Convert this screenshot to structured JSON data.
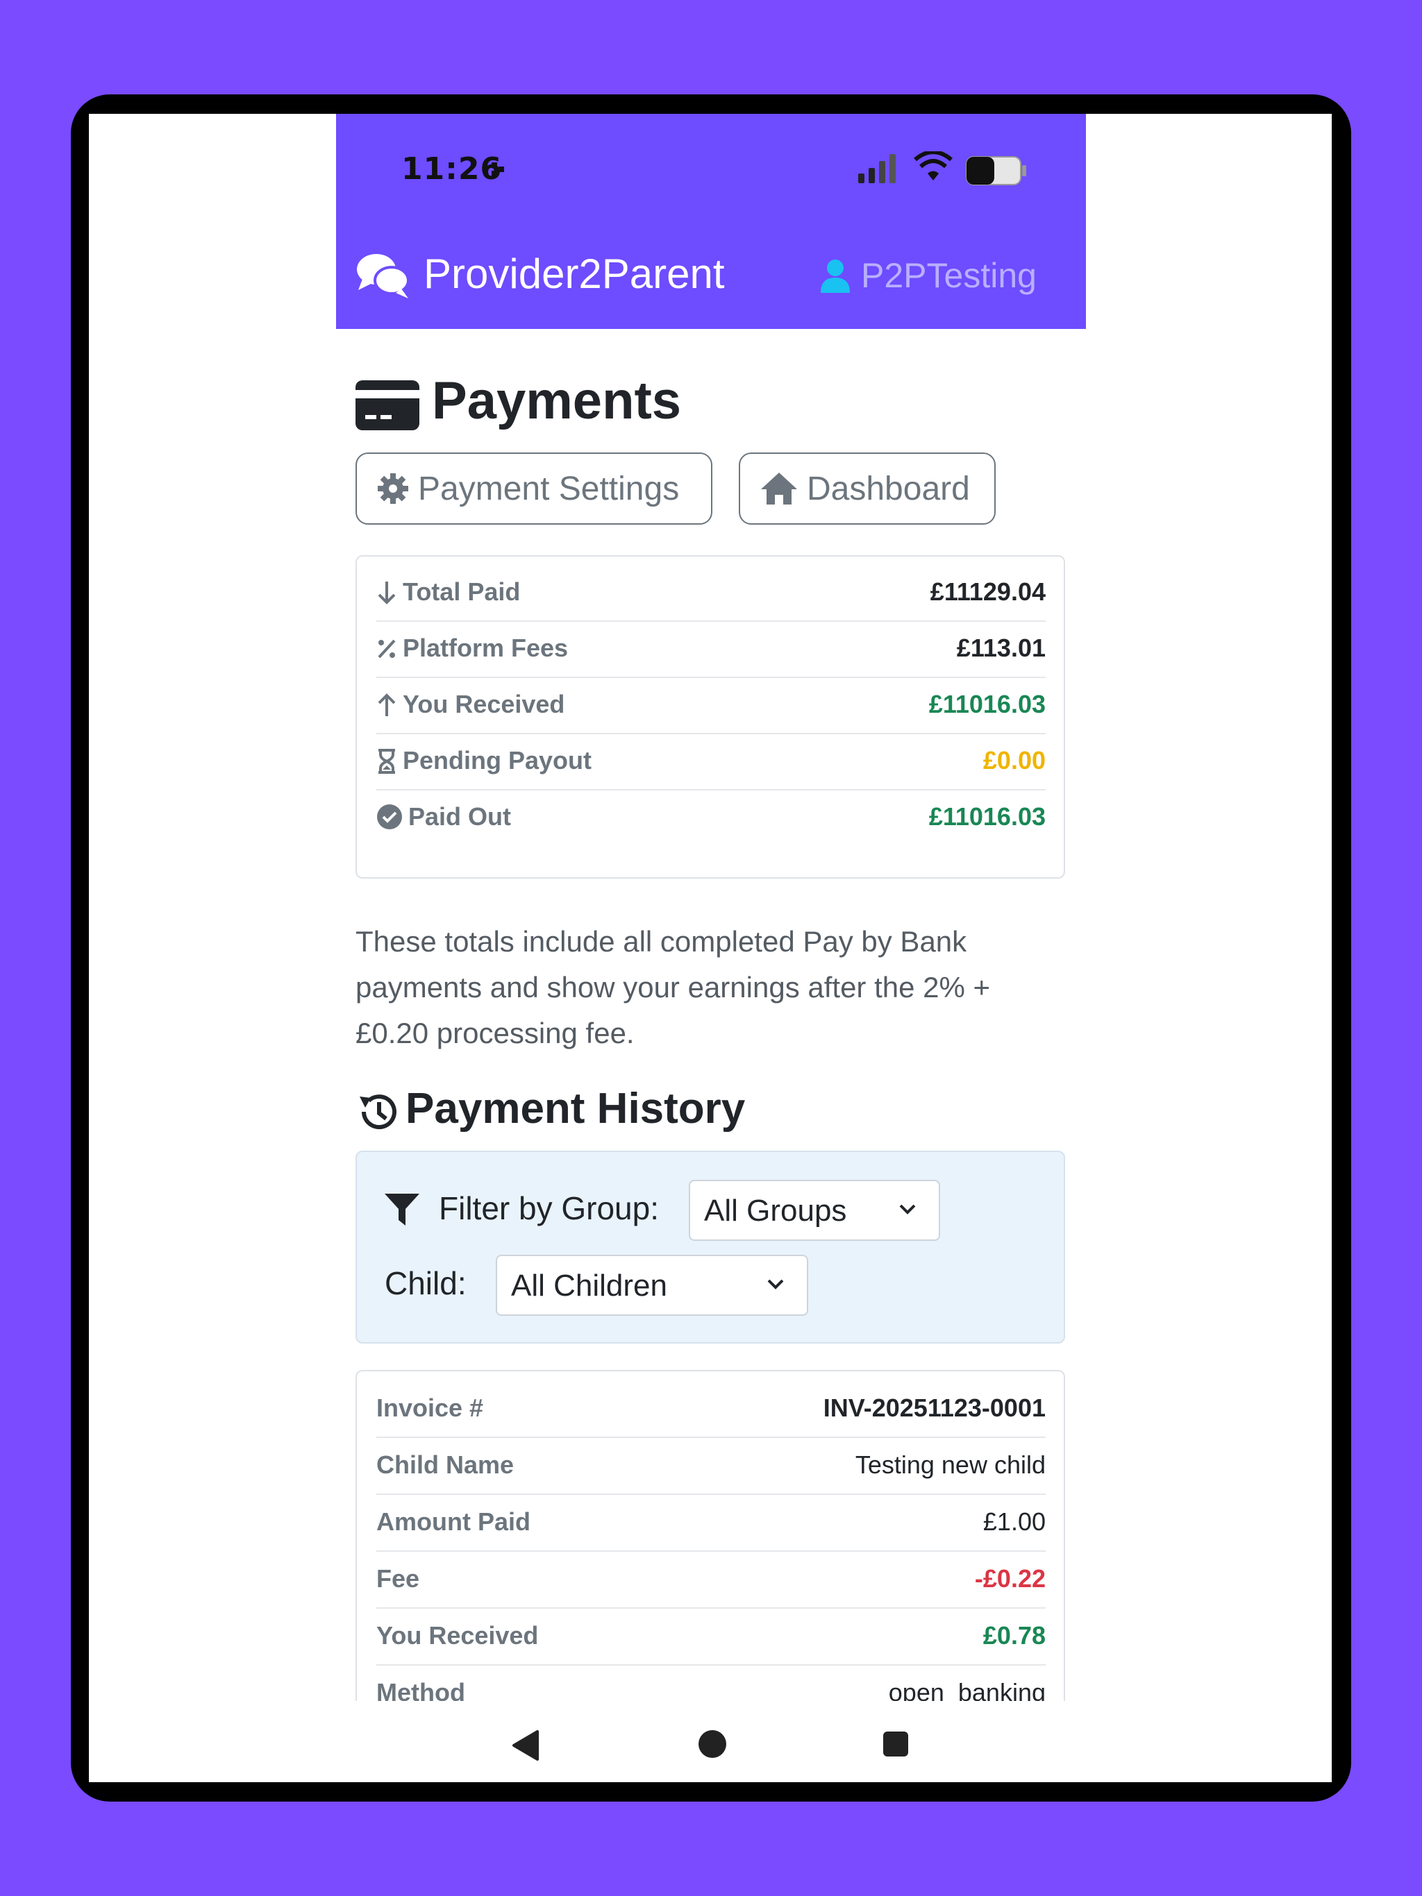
{
  "status": {
    "time": "11:26"
  },
  "header": {
    "brand": "Provider2Parent",
    "user": "P2PTesting"
  },
  "page": {
    "title": "Payments",
    "buttons": {
      "settings": "Payment Settings",
      "dashboard": "Dashboard"
    }
  },
  "summary": [
    {
      "icon": "arrow-down-icon",
      "label": "Total Paid",
      "value": "£11129.04",
      "color": "#212529"
    },
    {
      "icon": "percent-icon",
      "label": "Platform Fees",
      "value": "£113.01",
      "color": "#212529"
    },
    {
      "icon": "arrow-up-icon",
      "label": "You Received",
      "value": "£11016.03",
      "color": "#198754"
    },
    {
      "icon": "hourglass-icon",
      "label": "Pending Payout",
      "value": "£0.00",
      "color": "#f0b400"
    },
    {
      "icon": "check-circle-icon",
      "label": "Paid Out",
      "value": "£11016.03",
      "color": "#198754"
    }
  ],
  "note": "These totals include all completed Pay by Bank payments and show your earnings after the 2% + £0.20 processing fee.",
  "history": {
    "title": "Payment History",
    "filter": {
      "group_label": "Filter by Group:",
      "group_value": "All Groups",
      "child_label": "Child:",
      "child_value": "All Children"
    },
    "invoice": [
      {
        "label": "Invoice #",
        "value": "INV-20251123-0001",
        "color": "#212529",
        "bold": true
      },
      {
        "label": "Child Name",
        "value": "Testing new child",
        "color": "#212529",
        "bold": false
      },
      {
        "label": "Amount Paid",
        "value": "£1.00",
        "color": "#212529",
        "bold": false
      },
      {
        "label": "Fee",
        "value": "-£0.22",
        "color": "#dc3545",
        "bold": true
      },
      {
        "label": "You Received",
        "value": "£0.78",
        "color": "#198754",
        "bold": true
      },
      {
        "label": "Method",
        "value": "open_banking",
        "color": "#212529",
        "bold": false
      }
    ]
  },
  "colors": {
    "brand": "#6e4cff",
    "background": "#7a4bff",
    "success": "#198754",
    "warning": "#f0b400",
    "danger": "#dc3545"
  }
}
